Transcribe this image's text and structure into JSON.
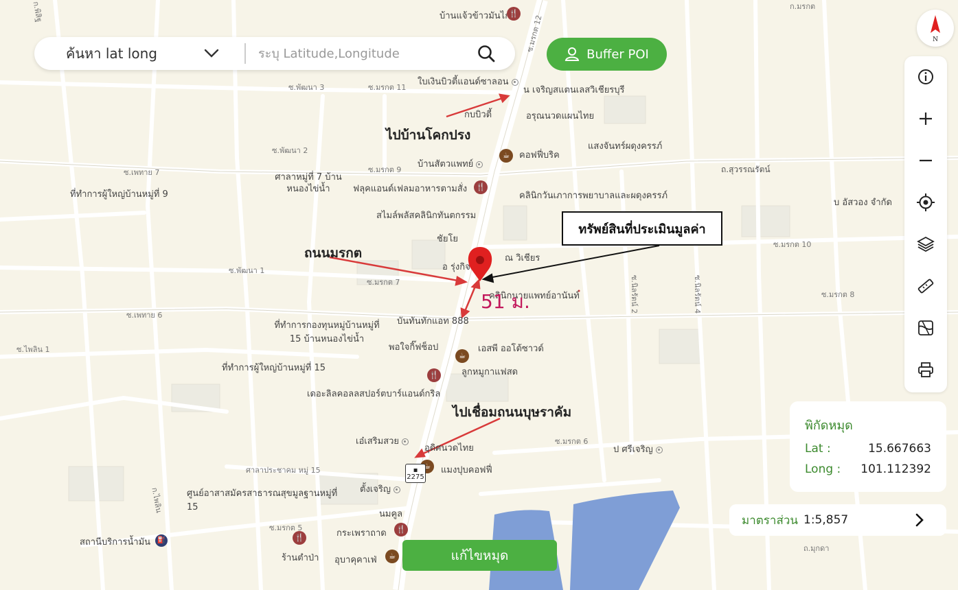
{
  "search": {
    "mode_label": "ค้นหา lat long",
    "placeholder": "ระบุ Latitude,Longitude"
  },
  "buffer_button": {
    "label": "Buffer POI"
  },
  "compass": {
    "north_label": "N"
  },
  "toolbar": {
    "icons": [
      "info-icon",
      "zoom-in-icon",
      "zoom-out-icon",
      "locate-icon",
      "layers-icon",
      "ruler-icon",
      "map-icon",
      "print-icon"
    ]
  },
  "coordinates": {
    "title": "พิกัดหมุด",
    "lat_label": "Lat :",
    "lat_value": "15.667663",
    "long_label": "Long :",
    "long_value": "101.112392"
  },
  "scale": {
    "label": "มาตราส่วน",
    "value": "1:5,857"
  },
  "edit_pin_button": {
    "label": "แก้ไขหมุด"
  },
  "annotations": {
    "to_khok_prong": "ไปบ้านโคกปรง",
    "road_morakot": "ถนนมรกต",
    "appraised_property": "ทรัพย์สินที่ประเมินมูลค่า",
    "distance": "51 ม.",
    "to_buracham": "ไปเชื่อมถนนบุษราคัม"
  },
  "route_shield": "2275",
  "colors": {
    "accent_green": "#4cb042",
    "pin_red": "#e02020",
    "water": "#7f9ed6",
    "annotation_arrow": "#d83a3a",
    "distance_text": "#c2185b"
  },
  "places": [
    "บ้านแจ้วข้าวมันไก่",
    "ใบเงินบิวตี้แอนด์ซาลอน",
    "น เจริญสแตนเลสวิเชียรบุรี",
    "กบบิวตี้",
    "อรุณนวดแผนไทย",
    "คอฟฟี่บริค",
    "แสงจันทร์ผดุงครรภ์",
    "บ้านสัตวแพทย์",
    "ศาลาหมู่ที่ 7 บ้านหนองไข่น้ำ",
    "ที่ทำการผู้ใหญ่บ้านหมู่ที่ 9",
    "ฟลุคแอนด์เฟลมอาหารตามสั่ง",
    "คลินิกวันเภาการพยาบาลและผดุงครรภ์",
    "สไมล์พลัสคลินิกทันตกรรม",
    "ชัยโย",
    "อ รุ่งกิจ",
    "ณ วิเชียร",
    "คลินิกนายแพทย์อานันท์",
    "บันทันทักแอท 888",
    "ที่ทำการกองทุนหมู่บ้านหมู่ที่ 15 บ้านหนองไข่น้ำ",
    "พอใจกิ๊ฟช็อป",
    "เอสพี ออโต้ซาวด์",
    "ที่ทำการผู้ใหญ่บ้านหมู่ที่ 15",
    "ลูกหมูกาแฟสด",
    "เดอะลิลคอลลสปอร์ตบาร์แอนด์กริล",
    "เอ๋เสริมสวย",
    "อุดิศนวดไทย",
    "แมงปุบคอฟฟี่",
    "ศาลาประชาคม หมู่ 15",
    "ศูนย์อาสาสมัครสาธารณสุขมูลฐานหมู่ที่ 15",
    "ตั้งเจริญ",
    "นมคูล",
    "กระเพราถาด",
    "สถานีบริการน้ำมัน",
    "ร้านตำป่า",
    "อุบาคุคาเฟ่",
    "บ อัสวอง จำกัด",
    "ป ศรีเจริญ"
  ],
  "roads": [
    "ก.พิสิฐ",
    "ถนนมรกต",
    "ซ.พัฒนา 3",
    "ซ.มรกต 11",
    "ซ.พัฒนา 2",
    "ซ.มรกต 9",
    "ซ.เพทาย 7",
    "ถ.สุวรรณรัตน์",
    "ซ.พัฒนา 1",
    "ซ.มรกต 7",
    "ซ.มรกต 10",
    "ซ.มรกต 8",
    "ซ.เพทาย 6",
    "ซ.ไพลิน 1",
    "ซ.มรกต 6",
    "ซ.มรกต 5",
    "ก.ไพลิน",
    "ถ.มุกดา",
    "ก.มรกต",
    "ซ.นิลรัตน์ 2",
    "ซ.นิลรัตน์ 4",
    "ซ.มรกต 12"
  ]
}
